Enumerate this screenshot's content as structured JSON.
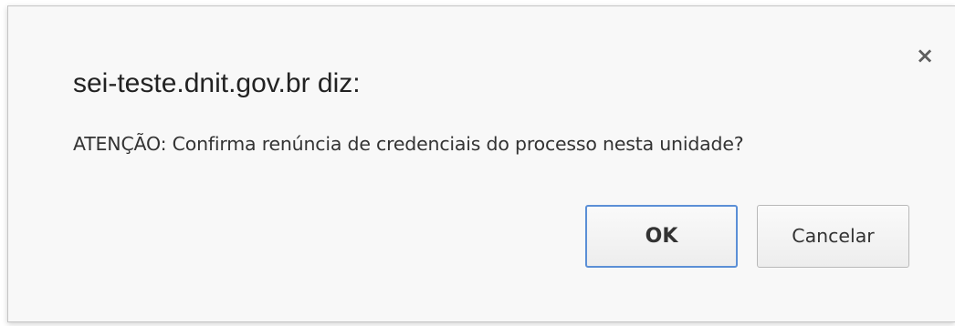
{
  "dialog": {
    "title": "sei-teste.dnit.gov.br diz:",
    "message": "ATENÇÃO: Confirma renúncia de credenciais do processo nesta unidade?",
    "close_label": "×",
    "close_icon": "close-icon",
    "buttons": {
      "ok_label": "OK",
      "cancel_label": "Cancelar"
    },
    "colors": {
      "background": "#f8f8f8",
      "focus_border": "#5b8fd6",
      "text": "#333333"
    }
  }
}
